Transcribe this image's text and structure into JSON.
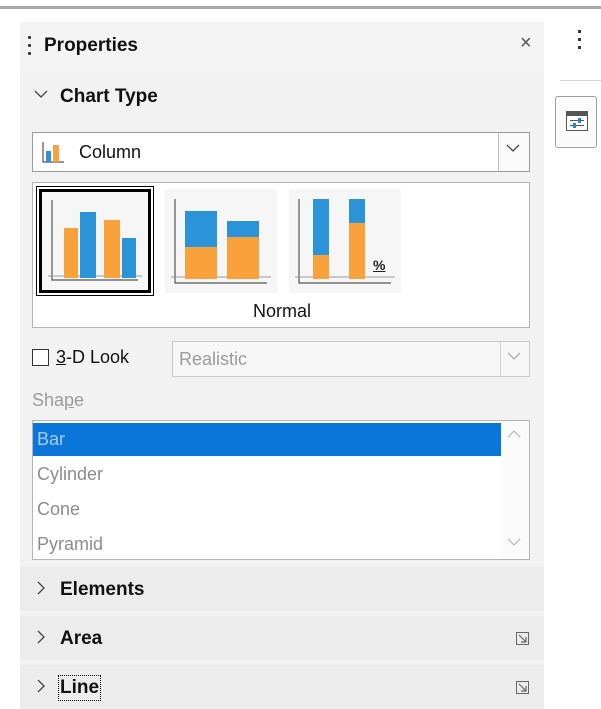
{
  "panel": {
    "title": "Properties",
    "close_symbol": "×"
  },
  "chart_type_section": {
    "header": "Chart Type",
    "type_dropdown": {
      "selected": "Column",
      "icon": "column-chart-icon"
    },
    "variants": [
      {
        "name": "normal",
        "icon": "column-normal-icon",
        "selected": true
      },
      {
        "name": "stacked",
        "icon": "column-stacked-icon",
        "selected": false
      },
      {
        "name": "percent-stacked",
        "icon": "column-percent-stacked-icon",
        "selected": false,
        "badge": "%"
      }
    ],
    "variant_caption": "Normal",
    "three_d": {
      "label_accel": "3",
      "label_rest": "-D Look",
      "checked": false,
      "look_value": "Realistic"
    },
    "shape": {
      "label_before": "Sha",
      "label_accel": "p",
      "label_after": "e",
      "items": [
        "Bar",
        "Cylinder",
        "Cone",
        "Pyramid"
      ],
      "selected": "Bar"
    }
  },
  "sections": [
    {
      "header": "Elements",
      "expanded": false
    },
    {
      "header": "Area",
      "expanded": false
    },
    {
      "header": "Line",
      "expanded": false
    }
  ],
  "colors": {
    "bar_orange": "#f9a23c",
    "bar_blue": "#2b93d8",
    "selection_blue": "#0b76d9"
  }
}
